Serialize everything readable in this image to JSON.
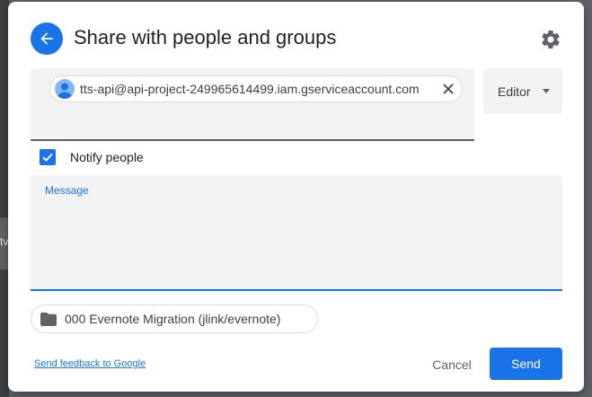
{
  "backdrop": {
    "glyph": "tv"
  },
  "header": {
    "title": "Share with people and groups",
    "back_icon": "arrow-left-icon",
    "settings_icon": "gear-icon"
  },
  "recipients": {
    "chips": [
      {
        "label": "tts-api@api-project-249965614499.iam.gserviceaccount.com",
        "avatar_icon": "person-icon",
        "remove_icon": "close-icon"
      }
    ]
  },
  "role": {
    "selected": "Editor",
    "caret_icon": "caret-down-icon"
  },
  "notify": {
    "label": "Notify people",
    "checked": true
  },
  "message": {
    "label": "Message",
    "value": ""
  },
  "item": {
    "label": "000 Evernote Migration (jlink/evernote)",
    "icon": "folder-icon"
  },
  "footer": {
    "feedback_link": "Send feedback to Google",
    "cancel_label": "Cancel",
    "send_label": "Send"
  },
  "colors": {
    "accent": "#1a73e8",
    "field_bg": "#f1f3f4",
    "overlay": "#5f6368"
  }
}
